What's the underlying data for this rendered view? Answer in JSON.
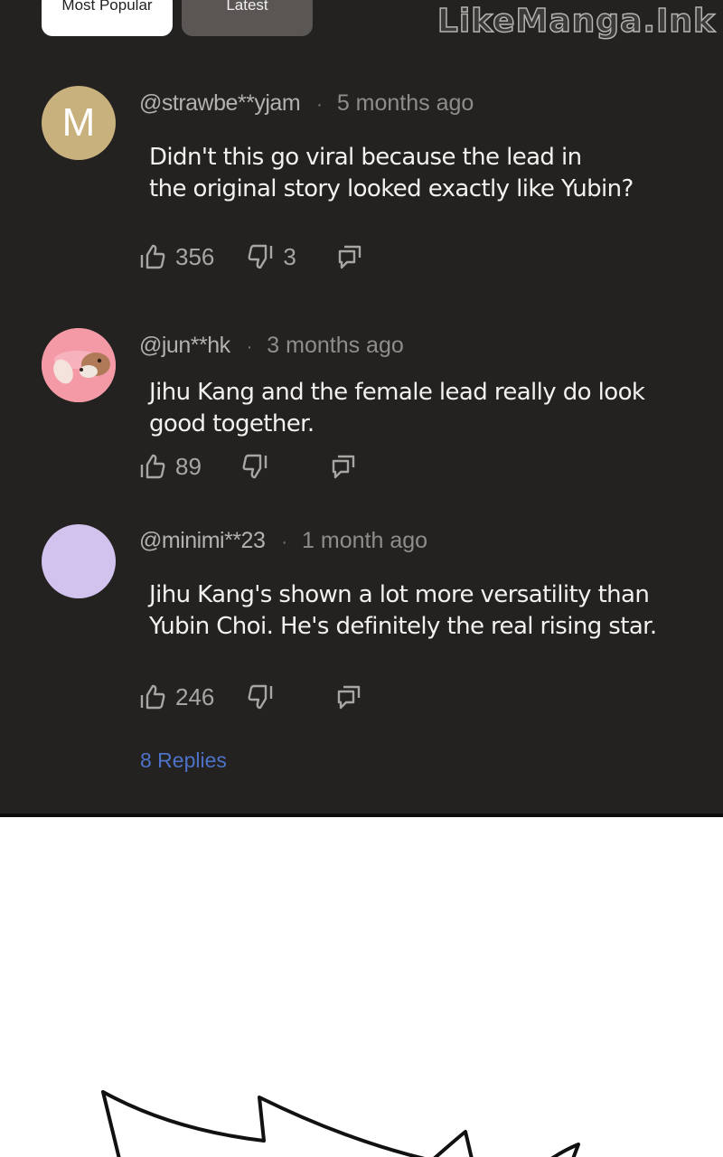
{
  "tabs": {
    "popular": "Most Popular",
    "latest": "Latest"
  },
  "watermark": "LikeManga.Ink",
  "comments": [
    {
      "avatar_letter": "M",
      "handle": "@strawbe**yjam",
      "separator": "·",
      "time": "5 months ago",
      "text": "Didn't this go viral because the lead in\nthe original story looked exactly like Yubin?",
      "likes": "356",
      "dislikes": "3"
    },
    {
      "handle": "@jun**hk",
      "separator": "·",
      "time": "3 months ago",
      "text": "Jihu Kang and the female lead really do look\ngood together.",
      "likes": "89",
      "dislikes": ""
    },
    {
      "handle": "@minimi**23",
      "separator": "·",
      "time": "1 month ago",
      "text": "Jihu Kang's shown a lot more versatility than\nYubin Choi. He's definitely the real rising star.",
      "likes": "246",
      "dislikes": ""
    }
  ],
  "replies_link": "8 Replies",
  "icons": [
    "thumbs-up-icon",
    "thumbs-down-icon",
    "reply-icon"
  ],
  "colors": {
    "panel": "#242221",
    "reply_link": "#4d72c8",
    "avatar_m": "#c8b17c",
    "avatar_pink": "#f49aa7",
    "avatar_lilac": "#d2c3ee"
  }
}
